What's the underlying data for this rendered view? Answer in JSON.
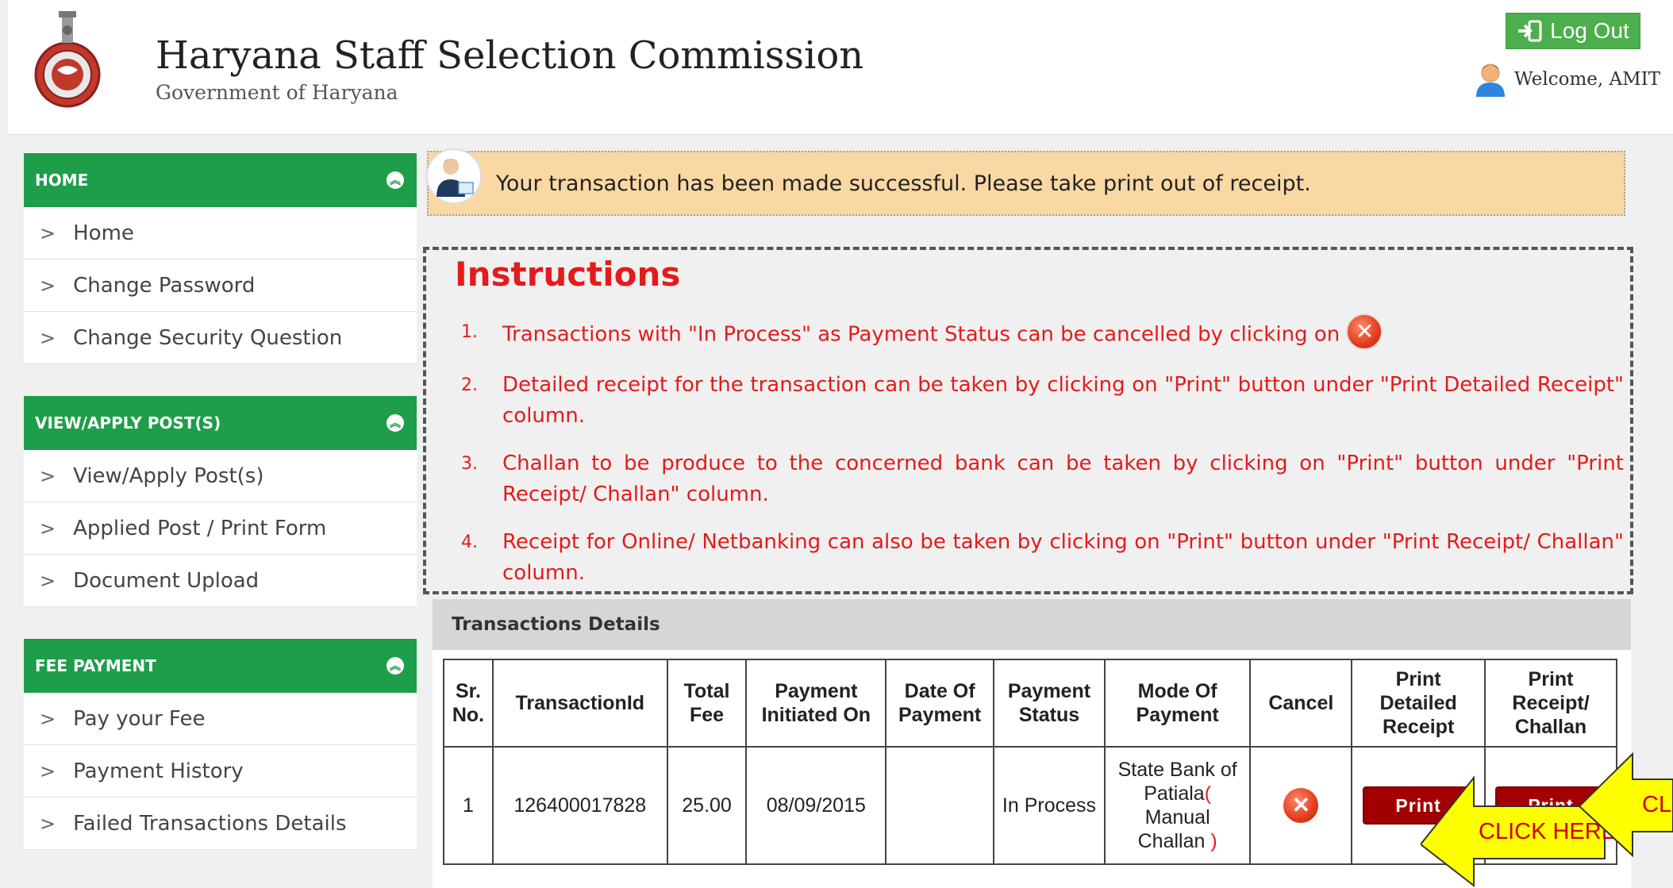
{
  "header": {
    "title": "Haryana Staff Selection Commission",
    "subtitle": "Government of Haryana",
    "logout_label": "Log Out",
    "welcome_text": "Welcome, AMIT"
  },
  "sidebar": {
    "sections": [
      {
        "title": "HOME",
        "items": [
          "Home",
          "Change Password",
          "Change Security Question"
        ]
      },
      {
        "title": "VIEW/APPLY POST(S)",
        "items": [
          "View/Apply Post(s)",
          "Applied Post / Print Form",
          "Document Upload"
        ]
      },
      {
        "title": "FEE PAYMENT",
        "items": [
          "Pay your Fee",
          "Payment History",
          "Failed Transactions Details"
        ]
      }
    ]
  },
  "alert": {
    "message": "Your transaction has been made successful. Please take print out of receipt."
  },
  "instructions": {
    "title": "Instructions",
    "items": [
      {
        "num": "1.",
        "text": "Transactions with \"In Process\" as Payment Status can be cancelled by clicking on"
      },
      {
        "num": "2.",
        "text": "Detailed receipt for the transaction can be taken by clicking on \"Print\" button under \"Print Detailed Receipt\" column."
      },
      {
        "num": "3.",
        "text": "Challan to be produce to the concerned bank can be taken by clicking on \"Print\" button under \"Print Receipt/ Challan\" column."
      },
      {
        "num": "4.",
        "text": "Receipt for Online/ Netbanking can also be taken by clicking on \"Print\" button under \"Print Receipt/ Challan\" column."
      }
    ]
  },
  "transactions": {
    "title": "Transactions Details",
    "headers": {
      "sr": "Sr. No.",
      "txn_id": "TransactionId",
      "total_fee": "Total Fee",
      "initiated_on": "Payment Initiated On",
      "date_of_payment": "Date Of Payment",
      "status": "Payment Status",
      "mode": "Mode Of Payment",
      "cancel": "Cancel",
      "print_detailed": "Print Detailed Receipt",
      "print_receipt": "Print Receipt/ Challan"
    },
    "rows": [
      {
        "sr": "1",
        "txn_id": "126400017828",
        "total_fee": "25.00",
        "initiated_on": "08/09/2015",
        "date_of_payment": "",
        "status": "In Process",
        "mode_main": "State Bank of Patiala",
        "mode_paren_open": "(",
        "mode_detail": "Manual Challan",
        "mode_paren_close": ")",
        "print_label": "Print",
        "print_label_2": "Print"
      }
    ]
  },
  "callouts": {
    "first": "CLICK HERE",
    "second": "CLI"
  },
  "colors": {
    "green": "#1e9e4a",
    "alert_bg": "#fad8a4",
    "instruction_red": "#e31b1b",
    "print_button": "#a20000",
    "callout_yellow": "#ffff00"
  }
}
